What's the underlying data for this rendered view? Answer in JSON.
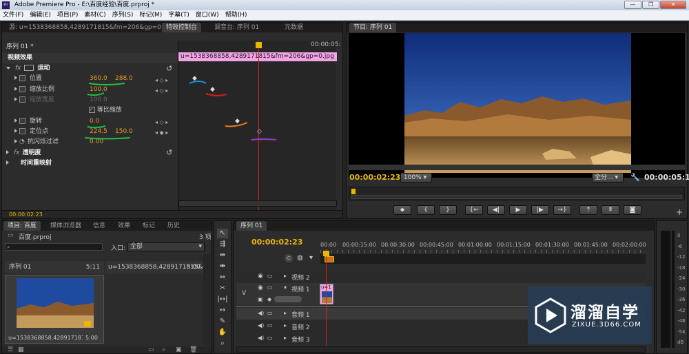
{
  "app": {
    "title": "Adobe Premiere Pro - E:\\百度经验\\百度.prproj *",
    "win_min": "—",
    "win_max": "❐",
    "win_close": "✕"
  },
  "menu": [
    "文件(F)",
    "编辑(E)",
    "项目(P)",
    "素材(C)",
    "序列(S)",
    "标记(M)",
    "字幕(T)",
    "窗口(W)",
    "帮助(H)"
  ],
  "source_panel": {
    "tabs": [
      "源: u=1538368858,4289171815&fm=206&gp=0.jpg",
      "特效控制台",
      "调音台: 序列 01",
      "元数据"
    ],
    "clip_header": "序列 01 * u=1538368858,4289171815&fm=206&gp=0.jpg",
    "time_right": "00:00:05:",
    "clip_bar": "u=1538368858,4289171815&fm=206&gp=0.jpg",
    "section": "视频效果",
    "current_time": "00:00:02:23",
    "effects": [
      {
        "name": "运动",
        "fx": "fx"
      },
      {
        "name": "位置",
        "v1": "360.0",
        "v2": "288.0"
      },
      {
        "name": "缩放比例",
        "v1": "100.0"
      },
      {
        "name": "缩放宽度",
        "v1": "100.0"
      },
      {
        "name": "等比缩放"
      },
      {
        "name": "旋转",
        "v1": "0.0"
      },
      {
        "name": "定位点",
        "v1": "224.5",
        "v2": "150.0"
      },
      {
        "name": "抗闪烁过滤",
        "v1": "0.00"
      },
      {
        "name": "透明度",
        "fx": "fx"
      },
      {
        "name": "时间重映射"
      }
    ]
  },
  "program": {
    "tab": "节目: 序列 01",
    "timecode": "00:00:02:23",
    "zoom": "100%",
    "quality": "全分...",
    "duration": "00:00:05:11"
  },
  "project": {
    "tabs": [
      "项目: 百度",
      "媒体浏览器",
      "信息",
      "效果",
      "标记",
      "历史"
    ],
    "filename": "百度.prproj",
    "items_count": "3 项",
    "entry_label": "入口:",
    "entry_value": "全部",
    "sequence_name": "序列 01",
    "sequence_duration": "5:11",
    "clip_name": "u=1538368858,4289171815&...",
    "clip_duration": "5:00",
    "thumb_caption": "u=1538368858,4289171815&fm...",
    "thumb_duration": "5:00"
  },
  "timeline": {
    "tab": "序列 01",
    "timecode": "00:00:02:23",
    "ruler": [
      "00:00",
      "00:00:15:00",
      "00:00:30:00",
      "00:00:45:00",
      "00:01:00:00",
      "00:01:15:00",
      "00:01:30:00",
      "00:01:45:00",
      "00:02:00:00"
    ],
    "tracks": [
      {
        "name": "视频 2"
      },
      {
        "name": "视频 1",
        "label": "V"
      },
      {
        "name": "音频 1"
      },
      {
        "name": "音频 2"
      },
      {
        "name": "音频 3"
      }
    ],
    "clip_label": "u=1"
  },
  "meter": {
    "labels": [
      "0",
      "-6",
      "-12",
      "-18",
      "-24",
      "-30",
      "-36",
      "-42",
      "-48",
      "-54",
      "dB"
    ]
  },
  "watermark": {
    "title": "溜溜自学",
    "url": "ZIXUE.3D66.COM"
  },
  "colors": {
    "accent": "#e8b800",
    "playhead": "#d02020",
    "clip_pink": "#f2a3e6"
  }
}
